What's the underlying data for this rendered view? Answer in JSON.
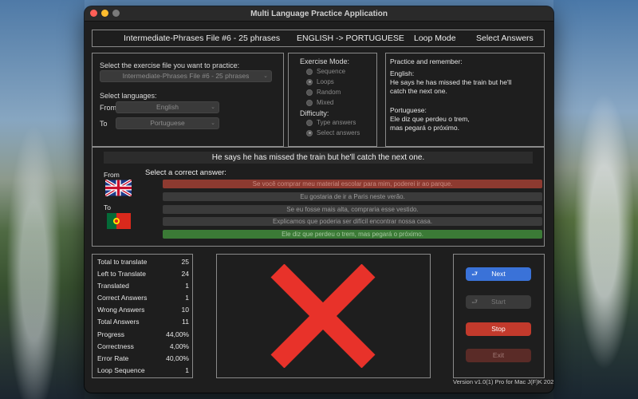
{
  "window": {
    "title": "Multi Language Practice Application"
  },
  "topbar": {
    "file": "Intermediate-Phrases File #6 - 25 phrases",
    "direction": "ENGLISH -> PORTUGUESE",
    "mode": "Loop Mode",
    "answer_mode": "Select Answers"
  },
  "setup": {
    "file_label": "Select the exercise file you want to practice:",
    "file_value": "Intermediate-Phrases File #6 - 25 phrases",
    "languages_label": "Select languages:",
    "from_label": "From",
    "from_value": "English",
    "to_label": "To",
    "to_value": "Portuguese"
  },
  "modes": {
    "exercise_label": "Exercise Mode:",
    "options": [
      "Sequence",
      "Loops",
      "Random",
      "Mixed"
    ],
    "selected": "Loops",
    "difficulty_label": "Difficulty:",
    "difficulty_options": [
      "Type answers",
      "Select answers"
    ],
    "difficulty_selected": "Select answers"
  },
  "practice": {
    "heading": "Practice and remember:",
    "english_label": "English:",
    "english_line1": "He says he has missed the train but he'll",
    "english_line2": "catch the next one.",
    "portuguese_label": "Portuguese:",
    "portuguese_line1": "Ele diz que perdeu o trem,",
    "portuguese_line2": "mas pegará o próximo."
  },
  "quiz": {
    "question": "He says he has missed the train but he'll catch the next one.",
    "from_label": "From",
    "to_label": "To",
    "prompt": "Select a correct answer:",
    "answers": [
      "Se você comprar meu material escolar para mim, poderei ir ao parque.",
      "Eu gostaria de ir a Paris neste verão.",
      "Se eu fosse mais alta, compraria esse vestido.",
      "Explicamos que poderia ser difícil encontrar nossa casa.",
      "Ele diz que perdeu o trem, mas pegará o próximo."
    ]
  },
  "stats": [
    {
      "label": "Total to translate",
      "value": "25"
    },
    {
      "label": "Left to Translate",
      "value": "24"
    },
    {
      "label": "Translated",
      "value": "1"
    },
    {
      "label": "Correct Answers",
      "value": "1"
    },
    {
      "label": "Wrong Answers",
      "value": "10"
    },
    {
      "label": "Total Answers",
      "value": "11"
    },
    {
      "label": "Progress",
      "value": "44,00%"
    },
    {
      "label": "Correctness",
      "value": "4,00%"
    },
    {
      "label": "Error Rate",
      "value": "40,00%"
    },
    {
      "label": "Loop Sequence",
      "value": "1"
    }
  ],
  "buttons": {
    "next": "Next",
    "start": "Start",
    "stop": "Stop",
    "exit": "Exit"
  },
  "version": "Version v1.0(1) Pro for Mac J(F)K 202",
  "colors": {
    "accent": "#3a72d8",
    "wrong": "#8d3a30",
    "right": "#3b7a36",
    "stop": "#c23a2c",
    "cross": "#e8322a"
  }
}
